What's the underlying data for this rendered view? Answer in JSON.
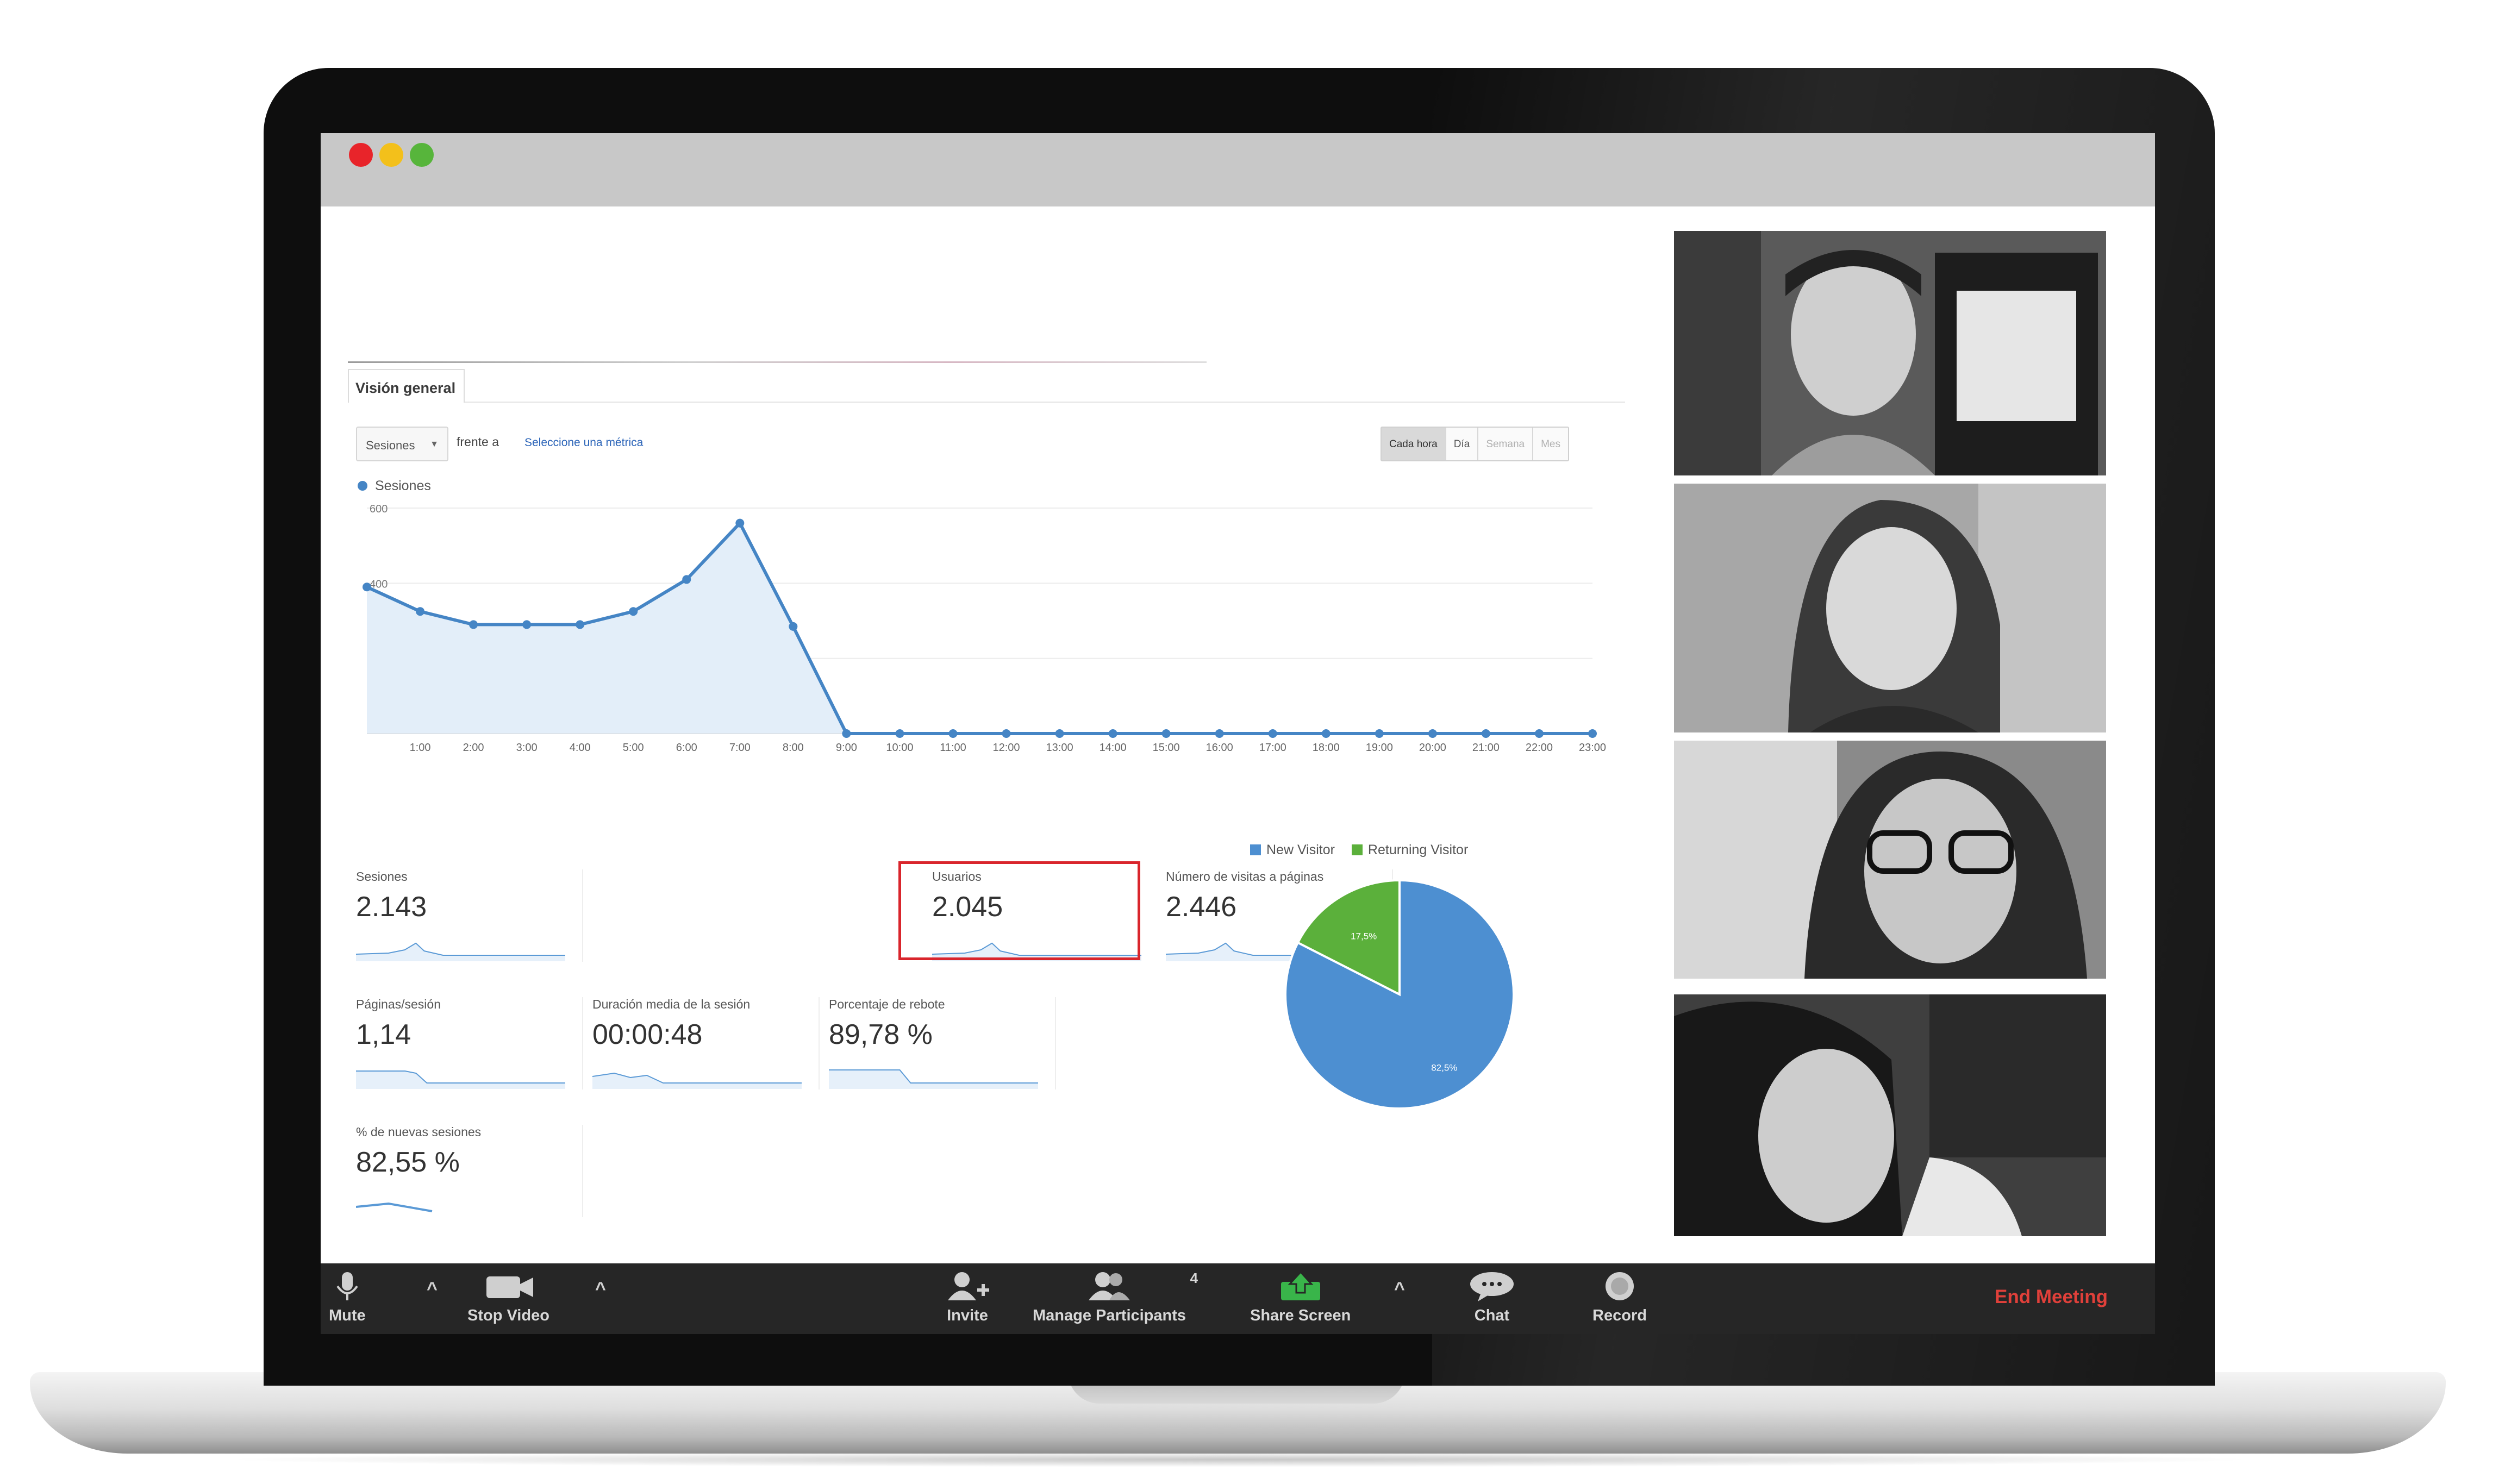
{
  "window": {
    "controls": [
      "close",
      "minimize",
      "maximize"
    ]
  },
  "analytics": {
    "tab_label": "Visión general",
    "metric_select": "Sesiones",
    "versus_label": "frente a",
    "compare_link": "Seleccione una métrica",
    "time_toggle": [
      "Cada hora",
      "Día",
      "Semana",
      "Mes"
    ],
    "series_legend": "Sesiones",
    "pie_legend": [
      "New Visitor",
      "Returning Visitor"
    ],
    "cards": {
      "sesiones": {
        "label": "Sesiones",
        "value": "2.143"
      },
      "usuarios": {
        "label": "Usuarios",
        "value": "2.045"
      },
      "visitas": {
        "label": "Número de visitas a páginas",
        "value": "2.446"
      },
      "paginas": {
        "label": "Páginas/sesión",
        "value": "1,14"
      },
      "duracion": {
        "label": "Duración media de la sesión",
        "value": "00:00:48"
      },
      "rebote": {
        "label": "Porcentaje de rebote",
        "value": "89,78 %"
      },
      "nuevas": {
        "label": "% de nuevas sesiones",
        "value": "82,55 %"
      }
    }
  },
  "chart_data": [
    {
      "type": "line",
      "title": "",
      "series": [
        {
          "name": "Sesiones",
          "values": [
            390,
            325,
            290,
            290,
            290,
            325,
            410,
            560,
            285,
            0,
            0,
            0,
            0,
            0,
            0,
            0,
            0,
            0,
            0,
            0,
            0,
            0,
            0,
            0
          ]
        }
      ],
      "x": [
        "",
        "1:00",
        "2:00",
        "3:00",
        "4:00",
        "5:00",
        "6:00",
        "7:00",
        "8:00",
        "9:00",
        "10:00",
        "11:00",
        "12:00",
        "13:00",
        "14:00",
        "15:00",
        "16:00",
        "17:00",
        "18:00",
        "19:00",
        "20:00",
        "21:00",
        "22:00",
        "23:00"
      ],
      "ylim": [
        0,
        600
      ],
      "yticks": [
        "600",
        "400",
        "200"
      ],
      "grid": true,
      "color": "#4585c5"
    },
    {
      "type": "pie",
      "categories": [
        "New Visitor",
        "Returning Visitor"
      ],
      "values": [
        82.5,
        17.5
      ],
      "labels": [
        "82,5%",
        "17,5%"
      ],
      "colors": [
        "#4d8fd1",
        "#5bb03b"
      ]
    }
  ],
  "video_tiles": [
    {
      "name": "participant-1"
    },
    {
      "name": "participant-2"
    },
    {
      "name": "participant-3"
    },
    {
      "name": "participant-4"
    }
  ],
  "toolbar": {
    "mute": "Mute",
    "stop_video": "Stop Video",
    "invite": "Invite",
    "manage_participants": "Manage Participants",
    "participant_count": "4",
    "share_screen": "Share Screen",
    "chat": "Chat",
    "record": "Record",
    "end_meeting": "End Meeting"
  }
}
